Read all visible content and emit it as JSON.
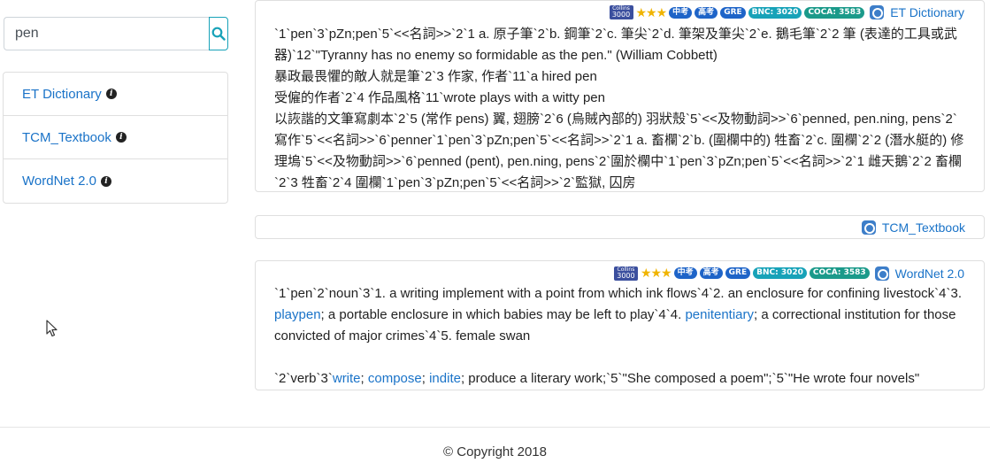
{
  "search": {
    "value": "pen"
  },
  "sidebar": {
    "items": [
      {
        "label": "ET Dictionary"
      },
      {
        "label": "TCM_Textbook"
      },
      {
        "label": "WordNet 2.0"
      }
    ]
  },
  "badges": {
    "tag3000_top": "Collins",
    "tag3000_bottom": "3000",
    "stars": "★★★",
    "zhongkao": "中考",
    "gaokao": "高考",
    "gre": "GRE",
    "bnc": "BNC: 3020",
    "coca": "COCA: 3583"
  },
  "cards": [
    {
      "source": "ET Dictionary",
      "lines": [
        "`1`pen`3`pZn;pen`5`<<名詞>>`2`1 a. 原子筆`2`b. 鋼筆`2`c. 筆尖`2`d. 筆架及筆尖`2`e. 鵝毛筆`2`2 筆 (表達的工具或武器)`12`\"Tyranny has no enemy so formidable as the pen.\" (William Cobbett)",
        "暴政最畏懼的敵人就是筆`2`3 作家, 作者`11`a hired pen",
        "受僱的作者`2`4 作品風格`11`wrote plays with a witty pen",
        "以詼諧的文筆寫劇本`2`5 (常作 pens) 翼, 翅膀`2`6 (烏賊內部的) 羽狀殼`5`<<及物動詞>>`6`penned, pen.ning, pens`2`寫作`5`<<名詞>>`6`penner`1`pen`3`pZn;pen`5`<<名詞>>`2`1 a. 畜欄`2`b. (圍欄中的) 牲畜`2`c. 圍欄`2`2 (潛水艇的) 修理塢`5`<<及物動詞>>`6`penned (pent), pen.ning, pens`2`圍於欄中`1`pen`3`pZn;pen`5`<<名詞>>`2`1 雌天鵝`2`2 畜欄`2`3 牲畜`2`4 圍欄`1`pen`3`pZn;pen`5`<<名詞>>`2`監獄, 囚房"
      ]
    },
    {
      "source": "TCM_Textbook"
    },
    {
      "source": "WordNet 2.0",
      "noun_parts": [
        "`1`pen`2`noun`3`1. a writing implement with a point from which ink flows`4`2. an enclosure for confining livestock`4`3. ",
        "playpen",
        "; a portable enclosure in which babies may be left to play`4`4. ",
        "penitentiary",
        "; a correctional institution for those convicted of major crimes`4`5. female swan"
      ],
      "verb_parts": [
        "`2`verb`3`",
        "write",
        "; ",
        "compose",
        "; ",
        "indite",
        "; produce a literary work;`5`\"She composed a poem\";`5`\"He wrote four novels\""
      ]
    }
  ],
  "footer": {
    "copyright": "© Copyright 2018"
  },
  "colors": {
    "link": "#1a73c8",
    "accent": "#17a2b8",
    "star": "#f0b400"
  }
}
